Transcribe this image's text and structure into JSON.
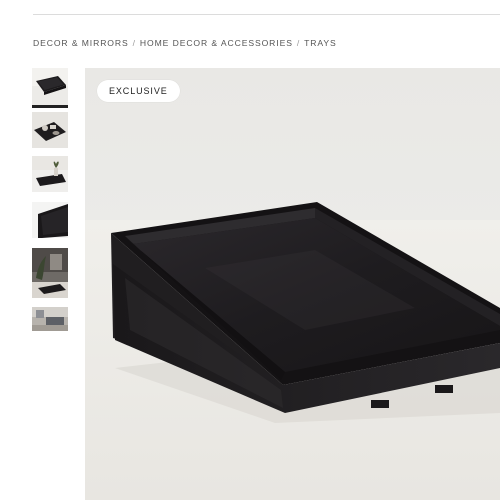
{
  "breadcrumb": {
    "items": [
      {
        "label": "DECOR & MIRRORS"
      },
      {
        "label": "HOME DECOR & ACCESSORIES"
      },
      {
        "label": "TRAYS"
      }
    ],
    "separator": "/"
  },
  "gallery": {
    "thumbnails": [
      {
        "icon": "tray-thumbnail",
        "active": true
      },
      {
        "icon": "tray-with-items-thumbnail",
        "active": false
      },
      {
        "icon": "tray-with-plant-thumbnail",
        "active": false
      },
      {
        "icon": "tray-closeup-thumbnail",
        "active": false
      },
      {
        "icon": "room-scene-thumbnail",
        "active": false
      },
      {
        "icon": "living-room-thumbnail",
        "active": false
      }
    ],
    "main_image": {
      "icon": "black-lacquer-tray-image",
      "badge": "EXCLUSIVE"
    }
  },
  "colors": {
    "background": "#ffffff",
    "badge_bg": "#ffffff",
    "tray": "#1c1a1c"
  }
}
